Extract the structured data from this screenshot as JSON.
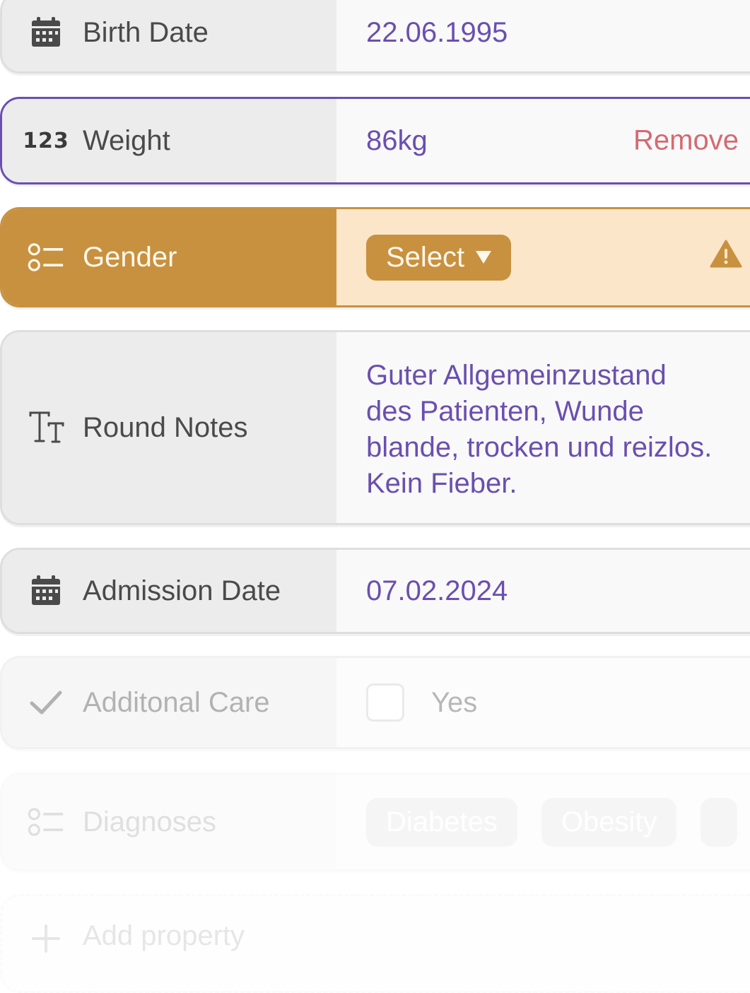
{
  "colors": {
    "accent": "#6a4fb0",
    "warning": "#c8913f",
    "warning_bg": "#fbe6c9",
    "remove": "#d46a73"
  },
  "properties": [
    {
      "id": "birth_date",
      "icon": "calendar-icon",
      "label": "Birth Date",
      "value": "22.06.1995"
    },
    {
      "id": "weight",
      "icon": "number-123-icon",
      "label": "Weight",
      "value": "86kg",
      "action": "Remove"
    },
    {
      "id": "gender",
      "icon": "select-list-icon",
      "label": "Gender",
      "select_label": "Select",
      "warning_icon": "warning-icon"
    },
    {
      "id": "round_notes",
      "icon": "text-type-icon",
      "label": "Round Notes",
      "value": "Guter Allgemeinzustand des Patienten, Wunde blande, trocken und reizlos. Kein Fieber."
    },
    {
      "id": "admission_date",
      "icon": "calendar-icon",
      "label": "Admission Date",
      "value": "07.02.2024"
    },
    {
      "id": "additional_care",
      "icon": "checkmark-icon",
      "label": "Additonal Care",
      "checkbox_label": "Yes",
      "checked": false
    },
    {
      "id": "diagnoses",
      "icon": "select-list-icon",
      "label": "Diagnoses",
      "chips": [
        "Diabetes",
        "Obesity"
      ]
    }
  ],
  "add_property": {
    "icon": "plus-icon",
    "label": "Add property"
  }
}
